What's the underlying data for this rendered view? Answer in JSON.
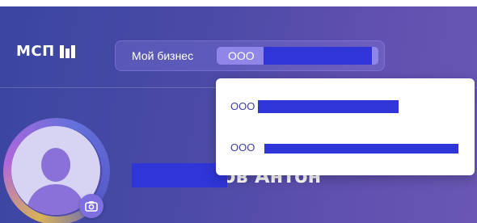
{
  "header": {
    "logo_text": "МСП",
    "biz_label": "Мой бизнес",
    "biz_selected": "ООО"
  },
  "dropdown": {
    "items": [
      {
        "prefix": "ООО"
      },
      {
        "prefix": "ООО"
      }
    ]
  },
  "profile": {
    "name_visible": "ов Антон"
  },
  "icons": {
    "camera": "camera-icon",
    "user": "user-silhouette-icon"
  },
  "colors": {
    "redaction": "#2f35d6",
    "accent": "#8f86e8"
  }
}
